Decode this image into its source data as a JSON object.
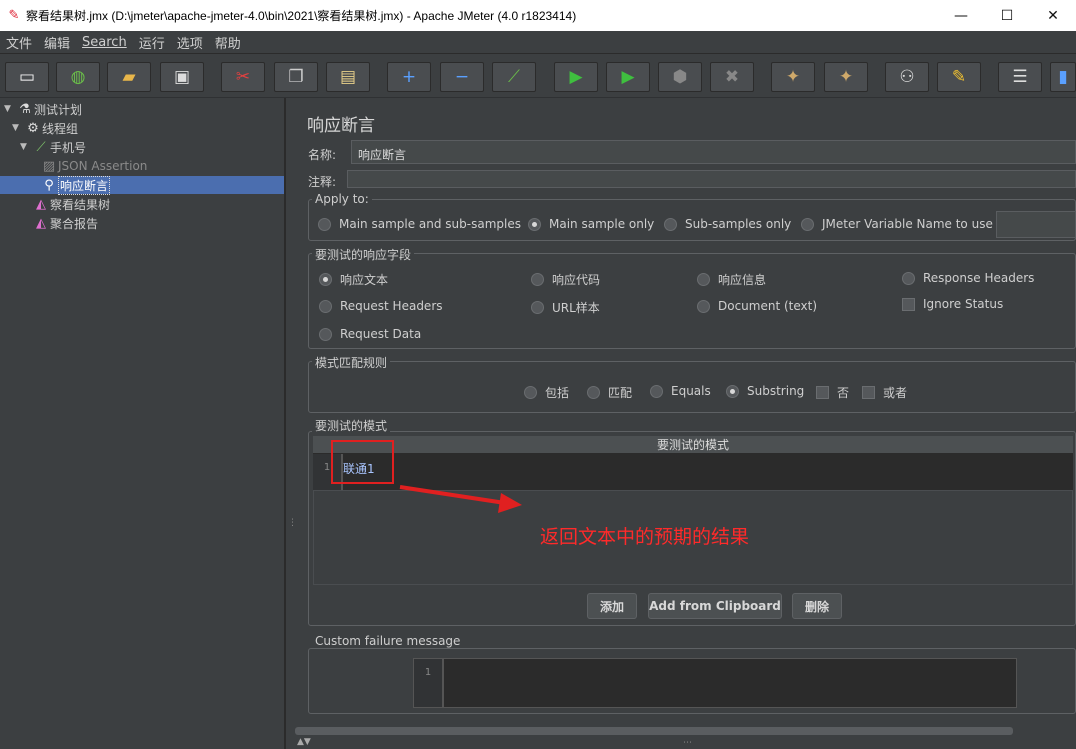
{
  "window": {
    "title": "察看结果树.jmx (D:\\jmeter\\apache-jmeter-4.0\\bin\\2021\\察看结果树.jmx) - Apache JMeter (4.0 r1823414)",
    "minimize": "—",
    "maximize": "☐",
    "close": "✕"
  },
  "menu": [
    "文件",
    "编辑",
    "Search",
    "运行",
    "选项",
    "帮助"
  ],
  "tree": {
    "items": [
      {
        "label": "测试计划"
      },
      {
        "label": "线程组"
      },
      {
        "label": "手机号"
      },
      {
        "label": "JSON Assertion"
      },
      {
        "label": "响应断言"
      },
      {
        "label": "察看结果树"
      },
      {
        "label": "聚合报告"
      }
    ]
  },
  "panel": {
    "title": "响应断言",
    "name_label": "名称:",
    "name_value": "响应断言",
    "comment_label": "注释:",
    "apply_to": {
      "title": "Apply to:",
      "options": [
        "Main sample and sub-samples",
        "Main sample only",
        "Sub-samples only",
        "JMeter Variable Name to use"
      ],
      "selected": "Main sample only"
    },
    "field_to_test": {
      "title": "要测试的响应字段",
      "options": [
        "响应文本",
        "响应代码",
        "响应信息",
        "Response Headers",
        "Request Headers",
        "URL样本",
        "Document (text)",
        "Ignore Status",
        "Request Data"
      ],
      "selected": "响应文本"
    },
    "matching_rules": {
      "title": "模式匹配规则",
      "options": [
        "包括",
        "匹配",
        "Equals",
        "Substring",
        "否",
        "或者"
      ],
      "selected": "Substring"
    },
    "patterns": {
      "title": "要测试的模式",
      "column_header": "要测试的模式",
      "line_number": "1",
      "value": "联通1"
    },
    "buttons": {
      "add": "添加",
      "add_clipboard": "Add from Clipboard",
      "delete": "删除"
    },
    "failure": {
      "title": "Custom failure message",
      "line_number": "1"
    }
  },
  "annotation": {
    "text": "返回文本中的预期的结果",
    "color": "#ff2a2a"
  }
}
